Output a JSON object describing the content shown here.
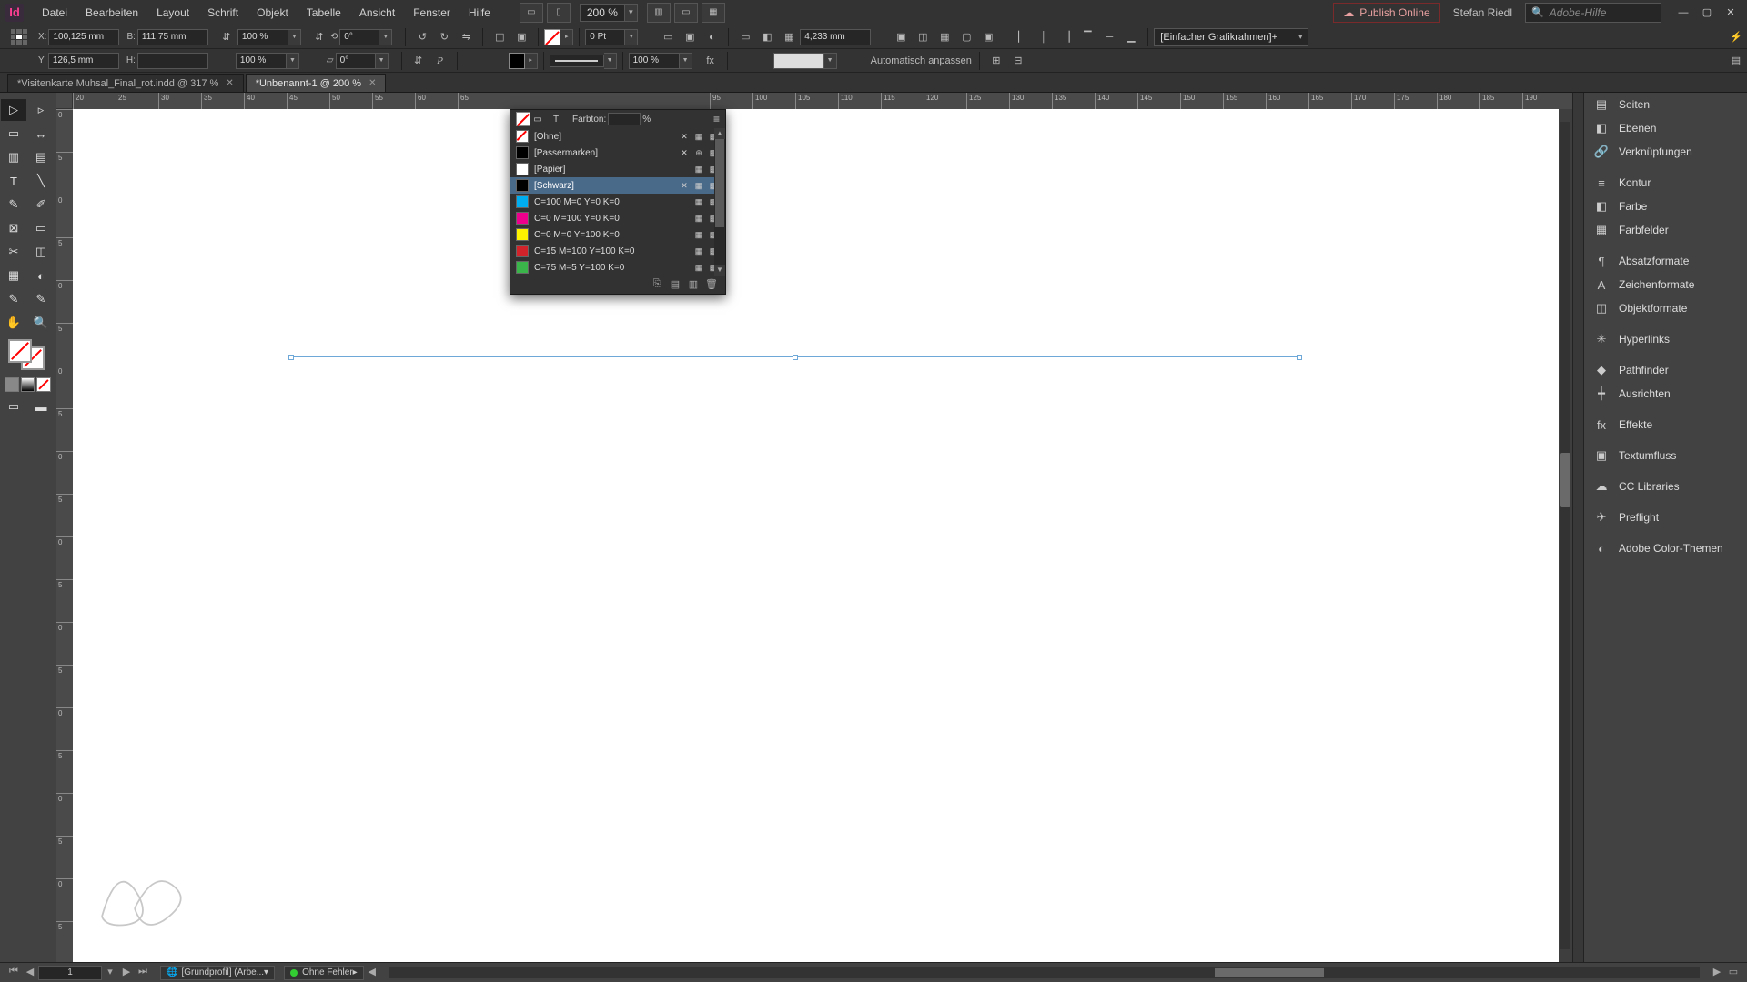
{
  "menubar": {
    "items": [
      "Datei",
      "Bearbeiten",
      "Layout",
      "Schrift",
      "Objekt",
      "Tabelle",
      "Ansicht",
      "Fenster",
      "Hilfe"
    ],
    "zoom": "200 %",
    "publish": "Publish Online",
    "user": "Stefan Riedl",
    "help_placeholder": "Adobe-Hilfe"
  },
  "control": {
    "x": "100,125 mm",
    "y": "126,5 mm",
    "w": "111,75 mm",
    "h": "",
    "scale_x": "100 %",
    "scale_y": "100 %",
    "rotate": "0°",
    "shear": "0°",
    "stroke_weight": "0 Pt",
    "opacity": "100 %",
    "fit_label": "Automatisch anpassen",
    "corner_val": "4,233 mm",
    "style_combo": "[Einfacher Grafikrahmen]+"
  },
  "tabs": [
    {
      "label": "*Visitenkarte Muhsal_Final_rot.indd @ 317 %",
      "active": false
    },
    {
      "label": "*Unbenannt-1 @ 200 %",
      "active": true
    }
  ],
  "ruler": {
    "h": [
      "20",
      "25",
      "30",
      "35",
      "40",
      "45",
      "50",
      "55",
      "60",
      "65",
      "95",
      "100",
      "105",
      "110",
      "115",
      "120",
      "125",
      "130",
      "135",
      "140",
      "145",
      "150",
      "155",
      "160",
      "165",
      "170",
      "175",
      "180",
      "185",
      "190"
    ],
    "v": [
      "5",
      "0",
      "5",
      "0",
      "5",
      "0",
      "5",
      "0",
      "5",
      "0",
      "5",
      "0",
      "5",
      "0",
      "5"
    ]
  },
  "swatches": {
    "tint_label": "Farbton:",
    "tint_unit": "%",
    "rows": [
      {
        "name": "[Ohne]",
        "color": "none",
        "locked": true,
        "reg": false,
        "selected": false
      },
      {
        "name": "[Passermarken]",
        "color": "#000",
        "locked": true,
        "reg": true,
        "selected": false
      },
      {
        "name": "[Papier]",
        "color": "#fff",
        "locked": false,
        "reg": false,
        "selected": false
      },
      {
        "name": "[Schwarz]",
        "color": "#000",
        "locked": true,
        "reg": false,
        "selected": true
      },
      {
        "name": "C=100 M=0 Y=0 K=0",
        "color": "#00AEEF",
        "locked": false,
        "reg": false,
        "selected": false
      },
      {
        "name": "C=0 M=100 Y=0 K=0",
        "color": "#EC008C",
        "locked": false,
        "reg": false,
        "selected": false
      },
      {
        "name": "C=0 M=0 Y=100 K=0",
        "color": "#FFF200",
        "locked": false,
        "reg": false,
        "selected": false
      },
      {
        "name": "C=15 M=100 Y=100 K=0",
        "color": "#D2232A",
        "locked": false,
        "reg": false,
        "selected": false
      },
      {
        "name": "C=75 M=5 Y=100 K=0",
        "color": "#39B54A",
        "locked": false,
        "reg": false,
        "selected": false
      }
    ]
  },
  "rightpanels": [
    {
      "icon": "▤",
      "label": "Seiten"
    },
    {
      "icon": "◧",
      "label": "Ebenen"
    },
    {
      "icon": "🔗",
      "label": "Verknüpfungen"
    },
    {
      "sep": true
    },
    {
      "icon": "≡",
      "label": "Kontur"
    },
    {
      "icon": "◧",
      "label": "Farbe"
    },
    {
      "icon": "▦",
      "label": "Farbfelder"
    },
    {
      "sep": true
    },
    {
      "icon": "¶",
      "label": "Absatzformate"
    },
    {
      "icon": "A",
      "label": "Zeichenformate"
    },
    {
      "icon": "◫",
      "label": "Objektformate"
    },
    {
      "sep": true
    },
    {
      "icon": "✳",
      "label": "Hyperlinks"
    },
    {
      "sep": true
    },
    {
      "icon": "◆",
      "label": "Pathfinder"
    },
    {
      "icon": "┿",
      "label": "Ausrichten"
    },
    {
      "sep": true
    },
    {
      "icon": "fx",
      "label": "Effekte"
    },
    {
      "sep": true
    },
    {
      "icon": "▣",
      "label": "Textumfluss"
    },
    {
      "sep": true
    },
    {
      "icon": "☁",
      "label": "CC Libraries"
    },
    {
      "sep": true
    },
    {
      "icon": "✈",
      "label": "Preflight"
    },
    {
      "sep": true
    },
    {
      "icon": "◐",
      "label": "Adobe Color-Themen"
    }
  ],
  "status": {
    "page": "1",
    "profile": "[Grundprofil] (Arbe...",
    "errors": "Ohne Fehler"
  }
}
